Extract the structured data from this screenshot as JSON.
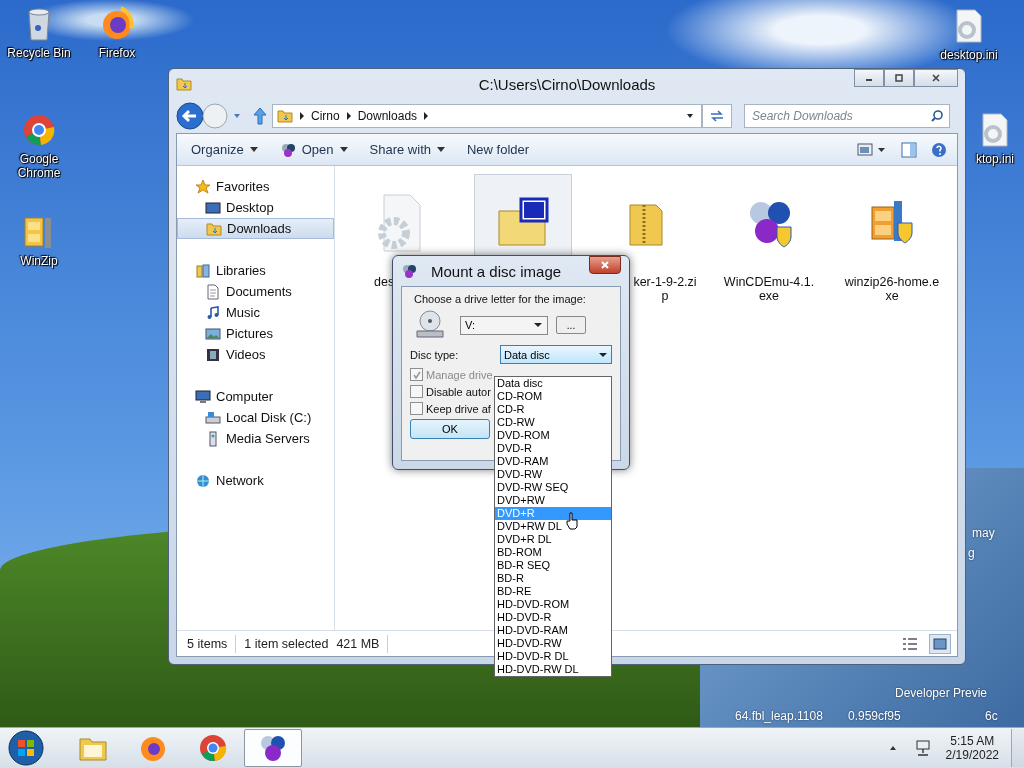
{
  "desktop_icons": [
    {
      "label": "Recycle Bin"
    },
    {
      "label": "Firefox"
    },
    {
      "label": "Google Chrome"
    },
    {
      "label": "WinZip"
    },
    {
      "label": "desktop.ini"
    },
    {
      "label": "ktop.ini"
    }
  ],
  "desktop_watermark": [
    "may",
    "g",
    "Developer Previe",
    "64.fbl_leap.1108",
    "0.959cf95",
    "6c"
  ],
  "explorer": {
    "title": "C:\\Users\\Cirno\\Downloads",
    "breadcrumb": [
      "Cirno",
      "Downloads"
    ],
    "search": {
      "placeholder": "Search Downloads"
    },
    "toolbar": [
      {
        "label": "Organize",
        "menu": true
      },
      {
        "label": "Open",
        "menu": true
      },
      {
        "label": "Share with",
        "menu": true
      },
      {
        "label": "New folder",
        "menu": false
      }
    ],
    "nav": [
      {
        "label": "Favorites",
        "children": [
          {
            "label": "Desktop",
            "selected": false
          },
          {
            "label": "Downloads",
            "selected": true
          }
        ]
      },
      {
        "label": "Libraries",
        "children": [
          {
            "label": "Documents",
            "selected": false
          },
          {
            "label": "Music",
            "selected": false
          },
          {
            "label": "Pictures",
            "selected": false
          },
          {
            "label": "Videos",
            "selected": false
          }
        ]
      },
      {
        "label": "Computer",
        "children": [
          {
            "label": "Local Disk (C:)",
            "selected": false
          },
          {
            "label": "Media Servers",
            "selected": false
          }
        ]
      },
      {
        "label": "Network"
      }
    ],
    "files": [
      {
        "label": "des",
        "selected": false
      },
      {
        "selected": true
      },
      {
        "label": "ker-1-9-2.zip",
        "selected": false
      },
      {
        "label": "WinCDEmu-4.1.exe",
        "selected": false
      },
      {
        "label": "winzip26-home.exe",
        "selected": false
      }
    ],
    "status": {
      "count": "5 items",
      "selection": "1 item selected",
      "size": "421 MB"
    },
    "views": [
      {
        "selected": false
      },
      {
        "selected": true
      }
    ]
  },
  "dialog": {
    "title": "Mount a disc image",
    "drive_prompt": "Choose a drive letter for the image:",
    "drive": "V:",
    "browse": "...",
    "disc_type_label": "Disc type:",
    "disc_type": "Data disc",
    "options": [
      {
        "label": "Manage drive",
        "checked": true,
        "disabled": true
      },
      {
        "label": "Disable autor",
        "checked": false,
        "disabled": false
      },
      {
        "label": "Keep drive af",
        "checked": false,
        "disabled": false
      }
    ],
    "ok": "OK",
    "disc_types": [
      {
        "label": "Data disc",
        "selected": false
      },
      {
        "label": "CD-ROM",
        "selected": false
      },
      {
        "label": "CD-R",
        "selected": false
      },
      {
        "label": "CD-RW",
        "selected": false
      },
      {
        "label": "DVD-ROM",
        "selected": false
      },
      {
        "label": "DVD-R",
        "selected": false
      },
      {
        "label": "DVD-RAM",
        "selected": false
      },
      {
        "label": "DVD-RW",
        "selected": false
      },
      {
        "label": "DVD-RW SEQ",
        "selected": false
      },
      {
        "label": "DVD+RW",
        "selected": false
      },
      {
        "label": "DVD+R",
        "selected": true
      },
      {
        "label": "DVD+RW DL",
        "selected": false
      },
      {
        "label": "DVD+R DL",
        "selected": false
      },
      {
        "label": "BD-ROM",
        "selected": false
      },
      {
        "label": "BD-R SEQ",
        "selected": false
      },
      {
        "label": "BD-R",
        "selected": false
      },
      {
        "label": "BD-RE",
        "selected": false
      },
      {
        "label": "HD-DVD-ROM",
        "selected": false
      },
      {
        "label": "HD-DVD-R",
        "selected": false
      },
      {
        "label": "HD-DVD-RAM",
        "selected": false
      },
      {
        "label": "HD-DVD-RW",
        "selected": false
      },
      {
        "label": "HD-DVD-R DL",
        "selected": false
      },
      {
        "label": "HD-DVD-RW DL",
        "selected": false
      }
    ]
  },
  "taskbar": {
    "apps": [
      {
        "selected": false
      },
      {
        "selected": false
      },
      {
        "selected": false
      },
      {
        "selected": true
      }
    ],
    "time": "5:15 AM",
    "date": "2/19/2022"
  }
}
